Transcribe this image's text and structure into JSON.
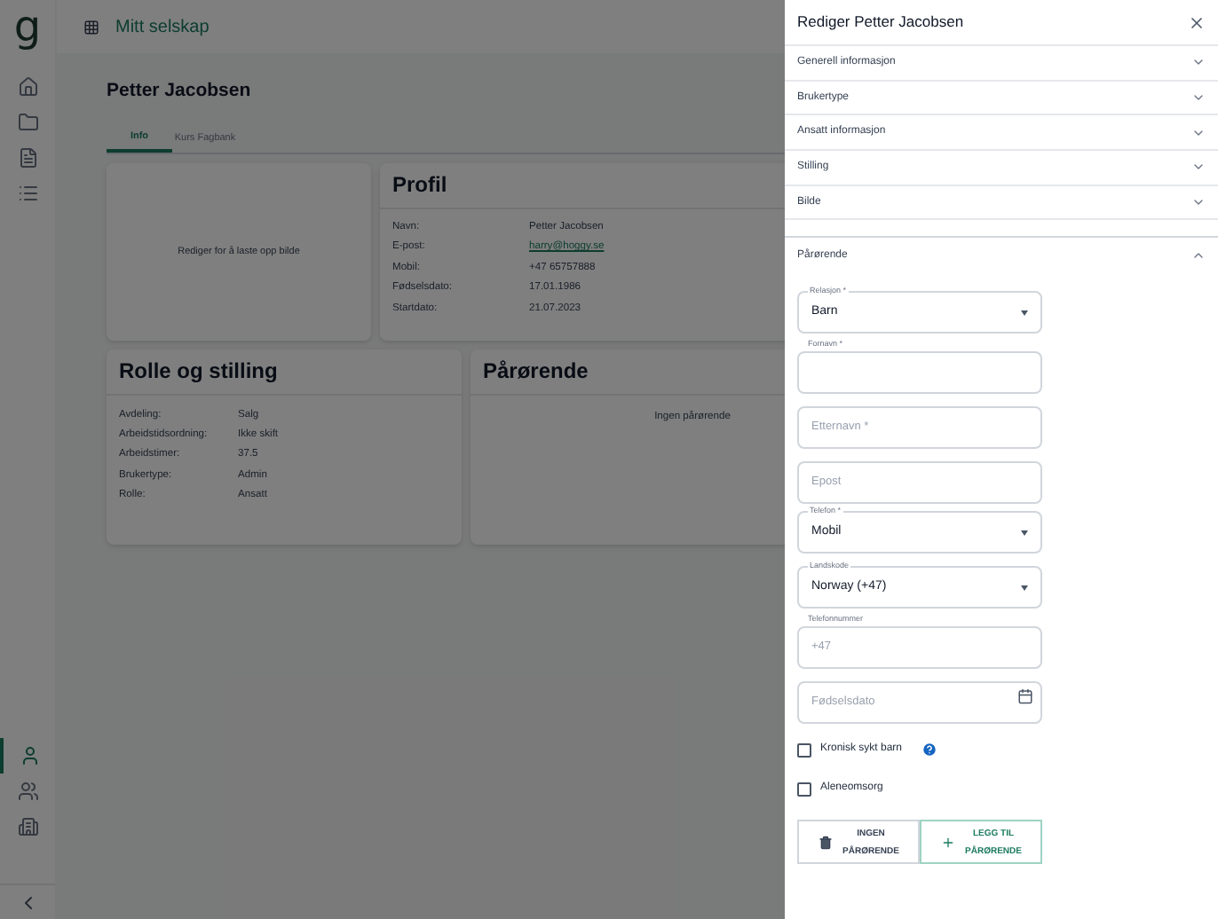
{
  "app": {
    "logo": "g",
    "company": "Mitt selskap"
  },
  "nav_top": [
    {
      "selected": false
    },
    {
      "selected": false
    },
    {
      "selected": false
    },
    {
      "selected": false
    }
  ],
  "nav_bottom": [
    {
      "selected": true
    },
    {
      "selected": false
    },
    {
      "selected": false
    }
  ],
  "page": {
    "title": "Petter Jacobsen",
    "tabs": [
      {
        "label": "Info",
        "selected": true
      },
      {
        "label": "Kurs Fagbank",
        "selected": false
      }
    ],
    "photo_card": {
      "text": "Rediger for å laste opp bilde"
    },
    "profile": {
      "title": "Profil",
      "rows": [
        {
          "label": "Navn:",
          "value": "Petter Jacobsen",
          "kind": "text"
        },
        {
          "label": "E-post:",
          "value": "harry@hoggy.se",
          "kind": "link"
        },
        {
          "label": "Mobil:",
          "value": "+47 65757888",
          "kind": "text"
        },
        {
          "label": "Fødselsdato:",
          "value": "17.01.1986",
          "kind": "text"
        },
        {
          "label": "Startdato:",
          "value": "21.07.2023",
          "kind": "text"
        }
      ]
    },
    "role": {
      "title": "Rolle og stilling",
      "rows": [
        {
          "label": "Avdeling:",
          "value": "Salg"
        },
        {
          "label": "Arbeidstidsordning:",
          "value": "Ikke skift"
        },
        {
          "label": "Arbeidstimer:",
          "value": "37.5"
        },
        {
          "label": "Brukertype:",
          "value": "Admin"
        },
        {
          "label": "Rolle:",
          "value": "Ansatt"
        }
      ]
    },
    "relatives": {
      "title": "Pårørende",
      "empty": "Ingen pårørende"
    }
  },
  "drawer": {
    "title": "Rediger Petter Jacobsen",
    "sections": [
      {
        "label": "Generell informasjon",
        "expanded": false
      },
      {
        "label": "Brukertype",
        "expanded": false
      },
      {
        "label": "Ansatt informasjon",
        "expanded": false
      },
      {
        "label": "Stilling",
        "expanded": false
      },
      {
        "label": "Bilde",
        "expanded": false
      },
      {
        "label": "Pårørende",
        "expanded": true
      }
    ],
    "fields": [
      {
        "kind": "select",
        "label": "Relasjon *",
        "value": "Barn"
      },
      {
        "kind": "input",
        "label": "Fornavn *"
      },
      {
        "kind": "input",
        "placeholder": "Etternavn *"
      },
      {
        "kind": "input",
        "placeholder": "Epost"
      },
      {
        "kind": "select",
        "label": "Telefon *",
        "value": "Mobil"
      },
      {
        "kind": "select",
        "label": "Landskode",
        "value": "Norway (+47)"
      },
      {
        "kind": "input",
        "label": "Telefonnummer",
        "placeholder": "+47"
      },
      {
        "kind": "date",
        "placeholder": "Fødselsdato"
      }
    ],
    "checkboxes": [
      {
        "label": "Kronisk sykt barn",
        "checked": false,
        "help": true
      },
      {
        "label": "Aleneomsorg",
        "checked": false,
        "help": false
      }
    ],
    "buttons": [
      {
        "kind": "delete",
        "lines": [
          "INGEN",
          "PÅRØRENDE"
        ]
      },
      {
        "kind": "add",
        "lines": [
          "LEGG TIL",
          "PÅRØRENDE"
        ]
      }
    ]
  }
}
